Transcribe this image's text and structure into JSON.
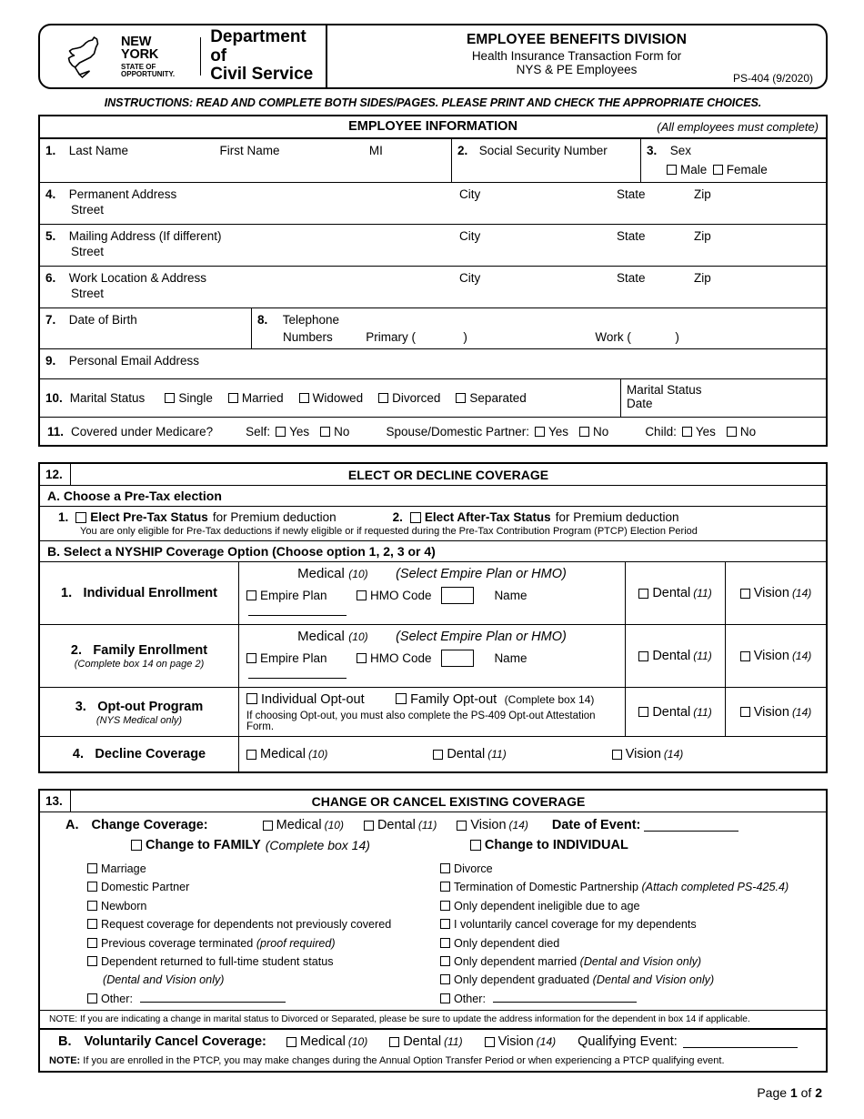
{
  "header": {
    "logo_state": "NEW YORK",
    "logo_sub1": "STATE OF",
    "logo_sub2": "OPPORTUNITY.",
    "dept_line1": "Department of",
    "dept_line2": "Civil Service",
    "title": "EMPLOYEE BENEFITS DIVISION",
    "subtitle1": "Health Insurance Transaction Form for",
    "subtitle2": "NYS & PE Employees",
    "form_number": "PS-404 (9/2020)"
  },
  "instructions": "INSTRUCTIONS:  READ AND COMPLETE BOTH SIDES/PAGES. PLEASE PRINT AND CHECK THE APPROPRIATE CHOICES.",
  "employee_information": {
    "section_title": "EMPLOYEE INFORMATION",
    "section_note": "(All employees must complete)",
    "f1_num": "1.",
    "f1_last": "Last Name",
    "f1_first": "First Name",
    "f1_mi": "MI",
    "f2_num": "2.",
    "f2_label": "Social Security Number",
    "f3_num": "3.",
    "f3_label": "Sex",
    "f3_male": "Male",
    "f3_female": "Female",
    "f4_num": "4.",
    "f4_label": "Permanent Address",
    "f4_street": "Street",
    "f5_num": "5.",
    "f5_label": "Mailing Address (If different)",
    "f5_street": "Street",
    "f6_num": "6.",
    "f6_label": "Work Location & Address",
    "f6_street": "Street",
    "city": "City",
    "state": "State",
    "zip": "Zip",
    "f7_num": "7.",
    "f7_label": "Date of Birth",
    "f8_num": "8.",
    "f8_label1": "Telephone",
    "f8_label2": "Numbers",
    "f8_primary": "Primary (",
    "f8_primary_close": ")",
    "f8_work": "Work (",
    "f8_work_close": ")",
    "f9_num": "9.",
    "f9_label": "Personal Email Address",
    "f10_num": "10.",
    "f10_label": "Marital Status",
    "f10_options": [
      "Single",
      "Married",
      "Widowed",
      "Divorced",
      "Separated"
    ],
    "f10_date_l1": "Marital Status",
    "f10_date_l2": "Date",
    "f11_num": "11.",
    "f11_label": "Covered under Medicare?",
    "f11_self": "Self:",
    "f11_spouse": "Spouse/Domestic Partner:",
    "f11_child": "Child:",
    "yes": "Yes",
    "no": "No"
  },
  "section12": {
    "number": "12.",
    "title": "ELECT OR DECLINE COVERAGE",
    "partA_head": "A. Choose a Pre-Tax election",
    "a1_num": "1.",
    "a1_bold": "Elect Pre-Tax Status",
    "a1_rest": "for Premium deduction",
    "a2_num": "2.",
    "a2_bold": "Elect After-Tax Status",
    "a2_rest": "for Premium deduction",
    "a_note": "You are only eligible for Pre-Tax deductions if newly eligible or if requested during the Pre-Tax Contribution Program (PTCP) Election Period",
    "partB_head": "B. Select a NYSHIP Coverage Option (Choose option 1, 2, 3 or 4)",
    "opt1_num": "1.",
    "opt1_name": "Individual Enrollment",
    "opt2_num": "2.",
    "opt2_name": "Family Enrollment",
    "opt2_sub": "(Complete box 14 on page 2)",
    "opt3_num": "3.",
    "opt3_name": "Opt-out Program",
    "opt3_sub": "(NYS Medical only)",
    "opt4_num": "4.",
    "opt4_name": "Decline Coverage",
    "medical": "Medical",
    "medical_ref": "(10)",
    "select_plan": "(Select Empire Plan or HMO)",
    "empire_plan": "Empire Plan",
    "hmo_code": "HMO Code",
    "name": "Name",
    "dental": "Dental",
    "dental_ref": "(11)",
    "vision": "Vision",
    "vision_ref": "(14)",
    "individual_optout": "Individual Opt-out",
    "family_optout": "Family Opt-out",
    "family_optout_ref": "(Complete box 14)",
    "optout_note": "If choosing Opt-out, you must also complete the PS-409 Opt-out Attestation Form."
  },
  "section13": {
    "number": "13.",
    "title": "CHANGE OR CANCEL EXISTING COVERAGE",
    "a_label": "A.",
    "a_title": "Change Coverage:",
    "medical": "Medical",
    "medical_ref": "(10)",
    "dental": "Dental",
    "dental_ref": "(11)",
    "vision": "Vision",
    "vision_ref": "(14)",
    "date_of_event": "Date of Event:",
    "change_family_bold": "Change to FAMILY",
    "change_family_ital": "(Complete box 14)",
    "change_individual": "Change to INDIVIDUAL",
    "left_options": [
      {
        "text": "Marriage",
        "ital": ""
      },
      {
        "text": "Domestic Partner",
        "ital": ""
      },
      {
        "text": "Newborn",
        "ital": ""
      },
      {
        "text": "Request coverage for dependents not previously covered",
        "ital": ""
      },
      {
        "text": "Previous coverage terminated ",
        "ital": "(proof required)"
      },
      {
        "text": "Dependent returned to full-time student status",
        "ital": ""
      }
    ],
    "left_cont": "(Dental and Vision only)",
    "left_other": "Other:",
    "right_options": [
      {
        "text": "Divorce",
        "ital": ""
      },
      {
        "text": "Termination of Domestic Partnership ",
        "ital": "(Attach completed PS-425.4)"
      },
      {
        "text": "Only dependent ineligible due to age",
        "ital": ""
      },
      {
        "text": "I voluntarily cancel coverage for my dependents",
        "ital": ""
      },
      {
        "text": "Only dependent died",
        "ital": ""
      },
      {
        "text": "Only dependent married ",
        "ital": "(Dental and Vision only)"
      },
      {
        "text": "Only dependent graduated ",
        "ital": "(Dental and Vision only)"
      }
    ],
    "right_other": "Other:",
    "note1": "NOTE: If you are indicating  a change in marital  status to Divorced  or Separated, please be sure  to update the address  information  for the dependent in box 14 if applicable.",
    "b_label": "B.",
    "b_title": "Voluntarily Cancel Coverage:",
    "qualifying_event": "Qualifying Event:",
    "note2_bold": "NOTE:",
    "note2_rest": " If you are enrolled in the PTCP, you may make changes during the Annual Option Transfer Period or when experiencing a PTCP qualifying event."
  },
  "footer": {
    "page_pre": "Page ",
    "page_num": "1",
    "page_mid": " of ",
    "page_total": "2"
  }
}
